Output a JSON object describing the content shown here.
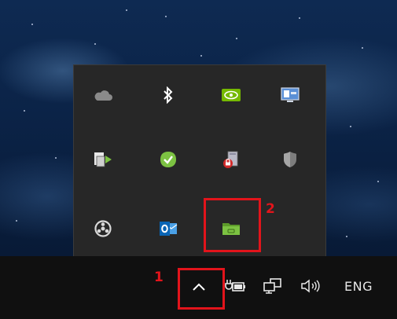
{
  "taskbar": {
    "language": "ENG",
    "icons": [
      "show-hidden-icons-chevron",
      "battery-power-icon",
      "network-icon",
      "volume-icon"
    ]
  },
  "tray_popup": {
    "rows": [
      [
        "onedrive-cloud-icon",
        "bluetooth-icon",
        "nvidia-icon",
        "monitor-settings-icon"
      ],
      [
        "device-sync-icon",
        "green-check-app-icon",
        "security-app-icon",
        "shield-icon"
      ],
      [
        "steering-wheel-icon",
        "outlook-icon",
        "green-folder-icon"
      ]
    ]
  },
  "annotations": {
    "marker_1": "1",
    "marker_2": "2"
  },
  "colors": {
    "annotation_red": "#e2141b",
    "popup_bg": "#272727",
    "taskbar_bg": "#101010",
    "accent_green": "#7cc242"
  }
}
